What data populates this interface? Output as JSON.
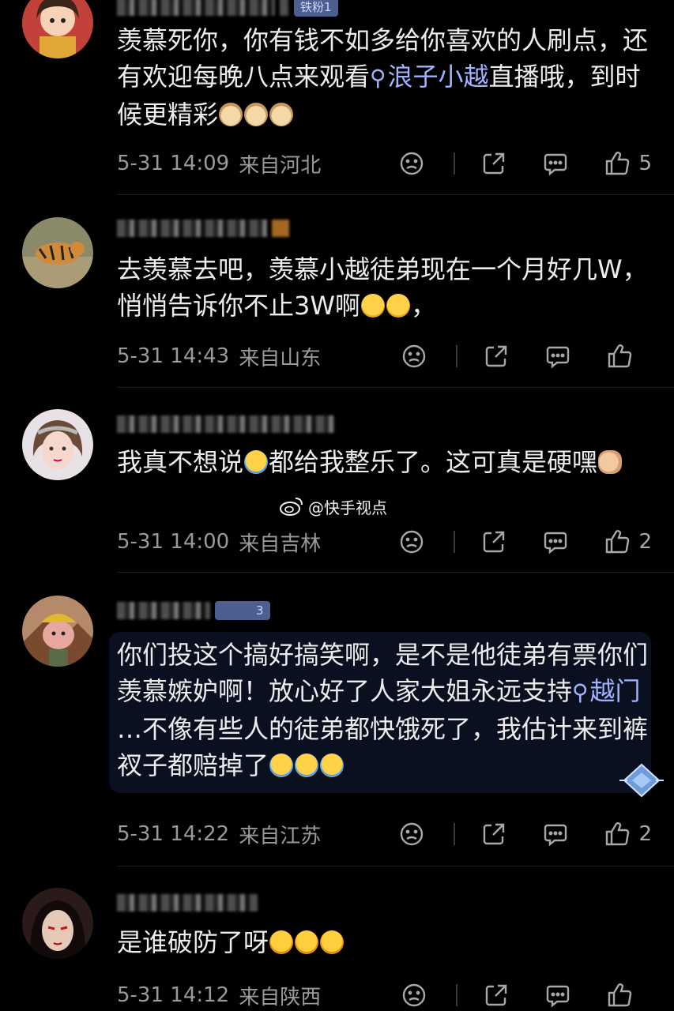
{
  "comments": [
    {
      "name_badge": "铁粉1",
      "text_a": "羡慕死你，你有钱不如多给你喜欢的人刷点，还有欢迎每晚八点来观看",
      "link": "浪子小越",
      "text_b": "直播哦，到时候更精彩",
      "time": "5-31 14:09",
      "location": "来自河北",
      "likes": "5"
    },
    {
      "text": "去羡慕去吧，羡慕小越徒弟现在一个月好几W，悄悄告诉你不止3W啊",
      "text_end": "，",
      "time": "5-31 14:43",
      "location": "来自山东",
      "likes": ""
    },
    {
      "text": "我真不想说",
      "text_b": "都给我整乐了。这可真是硬嘿",
      "time": "5-31 14:00",
      "location": "来自吉林",
      "likes": "2"
    },
    {
      "name_badge": "3",
      "text_a": "你们投这个搞好搞笑啊，是不是他徒弟有票你们羡慕嫉妒啊！放心好了人家大姐永远支持",
      "link": "越门",
      "text_b": " …不像有些人的徒弟都快饿死了，我估计来到裤衩子都赔掉了",
      "time": "5-31 14:22",
      "location": "来自江苏",
      "likes": "2"
    },
    {
      "text": "是谁破防了呀",
      "time": "5-31 14:12",
      "location": "来自陕西",
      "likes": ""
    }
  ],
  "watermark": "@快手视点",
  "icons": [
    "dislike-icon",
    "share-icon",
    "reply-icon",
    "like-icon",
    "search-icon",
    "weibo-icon"
  ],
  "colors": {
    "background": "#000000",
    "text": "#ececec",
    "meta": "#9a9a9a",
    "link": "#9fb4ff"
  }
}
